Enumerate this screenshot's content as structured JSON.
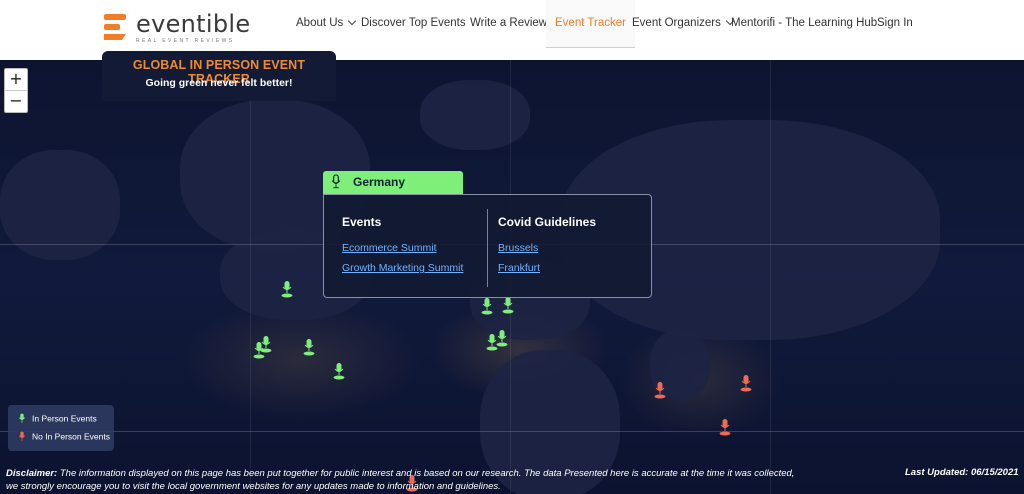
{
  "brand": {
    "name": "eventible",
    "tagline": "REAL EVENT REVIEWS",
    "accent": "#f07d28"
  },
  "nav": {
    "items": [
      {
        "label": "About Us",
        "dropdown": true
      },
      {
        "label": "Discover Top Events",
        "dropdown": false
      },
      {
        "label": "Write a Review",
        "dropdown": false
      },
      {
        "label": "Event Tracker",
        "dropdown": false,
        "active": true
      },
      {
        "label": "Event Organizers",
        "dropdown": true
      },
      {
        "label": "Mentorifi - The Learning Hub",
        "dropdown": false
      },
      {
        "label": "Sign In",
        "dropdown": false
      }
    ]
  },
  "map": {
    "zoom_in": "+",
    "zoom_out": "−",
    "tracker_title": "GLOBAL IN PERSON EVENT TRACKER",
    "tracker_subtitle": "Going green never felt better!",
    "in_person_color": "#7ef07a",
    "no_in_person_color": "#ee6a55"
  },
  "popup": {
    "country": "Germany",
    "events_heading": "Events",
    "events": [
      "Ecommerce Summit",
      "Growth Marketing Summit"
    ],
    "guidelines_heading": "Covid Guidelines",
    "guidelines": [
      "Brussels",
      "Frankfurt"
    ]
  },
  "legend": {
    "in_person": "In Person Events",
    "no_in_person": "No In Person Events"
  },
  "footer": {
    "disclaimer_label": "Disclaimer:",
    "disclaimer_text": "The information displayed on this page has been put together for public interest and is based on our research. The data Presented here is accurate at the time it was collected, we strongly encourage you to visit the local government websites for any updates made to information and guidelines.",
    "last_updated": "Last Updated: 06/15/2021"
  }
}
